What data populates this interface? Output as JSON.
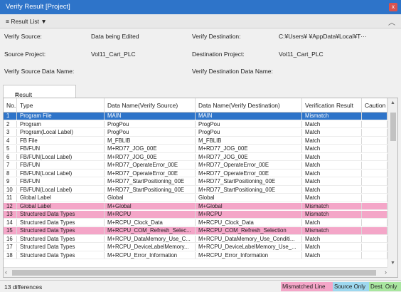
{
  "window": {
    "title": "Verify Result [Project]",
    "close_glyph": "x"
  },
  "result_list_bar": {
    "label": "Result List ▼",
    "collapse_glyph": "︿"
  },
  "info": {
    "verify_source_label": "Verify Source:",
    "verify_source_value": "Data being Edited",
    "verify_destination_label": "Verify Destination:",
    "verify_destination_value": "C:¥Users¥          ¥AppData¥Local¥T···",
    "source_project_label": "Source Project:",
    "source_project_value": "Vol11_Cart_PLC",
    "destination_project_label": "Destination Project:",
    "destination_project_value": "Vol11_Cart_PLC",
    "source_data_name_label": "Verify Source Data Name:",
    "destination_data_name_label": "Verify Destination Data Name:"
  },
  "tab": {
    "label": "Result List"
  },
  "table": {
    "columns": [
      "No.",
      "Type",
      "Data Name(Verify Source)",
      "Data Name(Verify Destination)",
      "Verification Result",
      "Caution"
    ],
    "rows": [
      {
        "no": "1",
        "type": "Program File",
        "src": "MAIN",
        "dst": "MAIN",
        "result": "Mismatch",
        "state": "selected"
      },
      {
        "no": "2",
        "type": "Program",
        "src": "ProgPou",
        "dst": "ProgPou",
        "result": "Match",
        "state": ""
      },
      {
        "no": "3",
        "type": "Program(Local Label)",
        "src": "ProgPou",
        "dst": "ProgPou",
        "result": "Match",
        "state": ""
      },
      {
        "no": "4",
        "type": "FB File",
        "src": "M_FBLIB",
        "dst": "M_FBLIB",
        "result": "Match",
        "state": ""
      },
      {
        "no": "5",
        "type": "FB/FUN",
        "src": "M+RD77_JOG_00E",
        "dst": "M+RD77_JOG_00E",
        "result": "Match",
        "state": ""
      },
      {
        "no": "6",
        "type": "FB/FUN(Local Label)",
        "src": "M+RD77_JOG_00E",
        "dst": "M+RD77_JOG_00E",
        "result": "Match",
        "state": ""
      },
      {
        "no": "7",
        "type": "FB/FUN",
        "src": "M+RD77_OperateError_00E",
        "dst": "M+RD77_OperateError_00E",
        "result": "Match",
        "state": ""
      },
      {
        "no": "8",
        "type": "FB/FUN(Local Label)",
        "src": "M+RD77_OperateError_00E",
        "dst": "M+RD77_OperateError_00E",
        "result": "Match",
        "state": ""
      },
      {
        "no": "9",
        "type": "FB/FUN",
        "src": "M+RD77_StartPositioning_00E",
        "dst": "M+RD77_StartPositioning_00E",
        "result": "Match",
        "state": ""
      },
      {
        "no": "10",
        "type": "FB/FUN(Local Label)",
        "src": "M+RD77_StartPositioning_00E",
        "dst": "M+RD77_StartPositioning_00E",
        "result": "Match",
        "state": ""
      },
      {
        "no": "11",
        "type": "Global Label",
        "src": "Global",
        "dst": "Global",
        "result": "Match",
        "state": ""
      },
      {
        "no": "12",
        "type": "Global Label",
        "src": "M+Global",
        "dst": "M+Global",
        "result": "Mismatch",
        "state": "mismatch"
      },
      {
        "no": "13",
        "type": "Structured Data Types",
        "src": "M+RCPU",
        "dst": "M+RCPU",
        "result": "Mismatch",
        "state": "mismatch"
      },
      {
        "no": "14",
        "type": "Structured Data Types",
        "src": "M+RCPU_Clock_Data",
        "dst": "M+RCPU_Clock_Data",
        "result": "Match",
        "state": ""
      },
      {
        "no": "15",
        "type": "Structured Data Types",
        "src": "M+RCPU_COM_Refresh_Selec...",
        "dst": "M+RCPU_COM_Refresh_Selection",
        "result": "Mismatch",
        "state": "mismatch"
      },
      {
        "no": "16",
        "type": "Structured Data Types",
        "src": "M+RCPU_DataMemory_Use_C...",
        "dst": "M+RCPU_DataMemory_Use_Conditi...",
        "result": "Match",
        "state": ""
      },
      {
        "no": "17",
        "type": "Structured Data Types",
        "src": "M+RCPU_DeviceLabelMemory...",
        "dst": "M+RCPU_DeviceLabelMemory_Use_...",
        "result": "Match",
        "state": ""
      },
      {
        "no": "18",
        "type": "Structured Data Types",
        "src": "M+RCPU_Error_Information",
        "dst": "M+RCPU_Error_Information",
        "result": "Match",
        "state": ""
      }
    ]
  },
  "status": {
    "count": "13 differences",
    "legend_mismatch": "Mismatched Line",
    "legend_source_only": "Source Only",
    "legend_dest_only": "Dest. Only"
  },
  "colors": {
    "title_bar": "#2e74c9",
    "selected_row": "#2e74c9",
    "mismatch_row": "#f4a6c8",
    "source_only": "#9ed8ef",
    "dest_only": "#a9e6a0"
  }
}
